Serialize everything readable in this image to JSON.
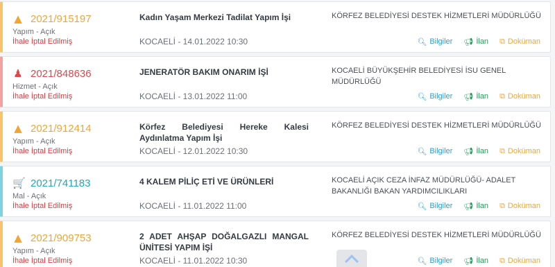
{
  "tenders": [
    {
      "category": "yapim",
      "icon": "road-icon",
      "icon_glyph": "▲",
      "id": "2021/915197",
      "type": "Yapım - Açık",
      "status": "İhale İptal Edilmiş",
      "title": "Kadın Yaşam Merkezi Tadilat Yapım İşi",
      "location_date": "KOCAELİ - 14.01.2022 10:30",
      "organization": "KÖRFEZ BELEDİYESİ DESTEK HİZMETLERİ MÜDÜRLÜĞÜ"
    },
    {
      "category": "hizmet",
      "icon": "person-icon",
      "icon_glyph": "♟",
      "id": "2021/848636",
      "type": "Hizmet - Açık",
      "status": "İhale İptal Edilmiş",
      "title": "JENERATÖR BAKIM ONARIM İŞİ",
      "location_date": "KOCAELİ - 13.01.2022 11:00",
      "organization": "KOCAELİ BÜYÜKŞEHİR BELEDİYESİ İSU GENEL MÜDÜRLÜĞÜ"
    },
    {
      "category": "yapim",
      "icon": "road-icon",
      "icon_glyph": "▲",
      "id": "2021/912414",
      "type": "Yapım - Açık",
      "status": "İhale İptal Edilmiş",
      "title": "Körfez Belediyesi Hereke Kalesi Aydınlatma Yapım İşi",
      "location_date": "KOCAELİ - 12.01.2022 10:30",
      "organization": "KÖRFEZ BELEDİYESİ DESTEK HİZMETLERİ MÜDÜRLÜĞÜ"
    },
    {
      "category": "mal",
      "icon": "cart-icon",
      "icon_glyph": "🛒",
      "id": "2021/741183",
      "type": "Mal - Açık",
      "status": "İhale İptal Edilmiş",
      "title": "4 KALEM PİLİÇ ETİ VE ÜRÜNLERİ",
      "location_date": "KOCAELİ - 11.01.2022 11:00",
      "organization": "KOCAELİ AÇIK CEZA İNFAZ MÜDÜRLÜĞÜ- ADALET BAKANLIĞI BAKAN YARDIMCILIKLARI"
    },
    {
      "category": "yapim",
      "icon": "road-icon",
      "icon_glyph": "▲",
      "id": "2021/909753",
      "type": "Yapım - Açık",
      "status": "İhale İptal Edilmiş",
      "title": "2 ADET AHŞAP DOĞALGAZLI MANGAL ÜNİTESİ YAPIM İŞİ",
      "location_date": "KOCAELİ - 11.01.2022 10:30",
      "organization": "KÖRFEZ BELEDİYESİ DESTEK HİZMETLERİ MÜDÜRLÜĞÜ"
    }
  ],
  "actions": {
    "info_label": "Bilgiler",
    "info_icon": "search-icon",
    "announcement_label": "İlan",
    "announcement_icon": "megaphone-icon",
    "document_label": "Doküman",
    "document_icon": "copy-icon"
  },
  "colors": {
    "yapim": "#f2a534",
    "hizmet": "#e0464a",
    "mal": "#1fa8c0",
    "status_cancelled": "#e03a3e",
    "info": "#2a9fd6",
    "announcement": "#1f9d55",
    "document": "#f2a534"
  },
  "scroll_to_top_icon": "chevron-up-icon"
}
